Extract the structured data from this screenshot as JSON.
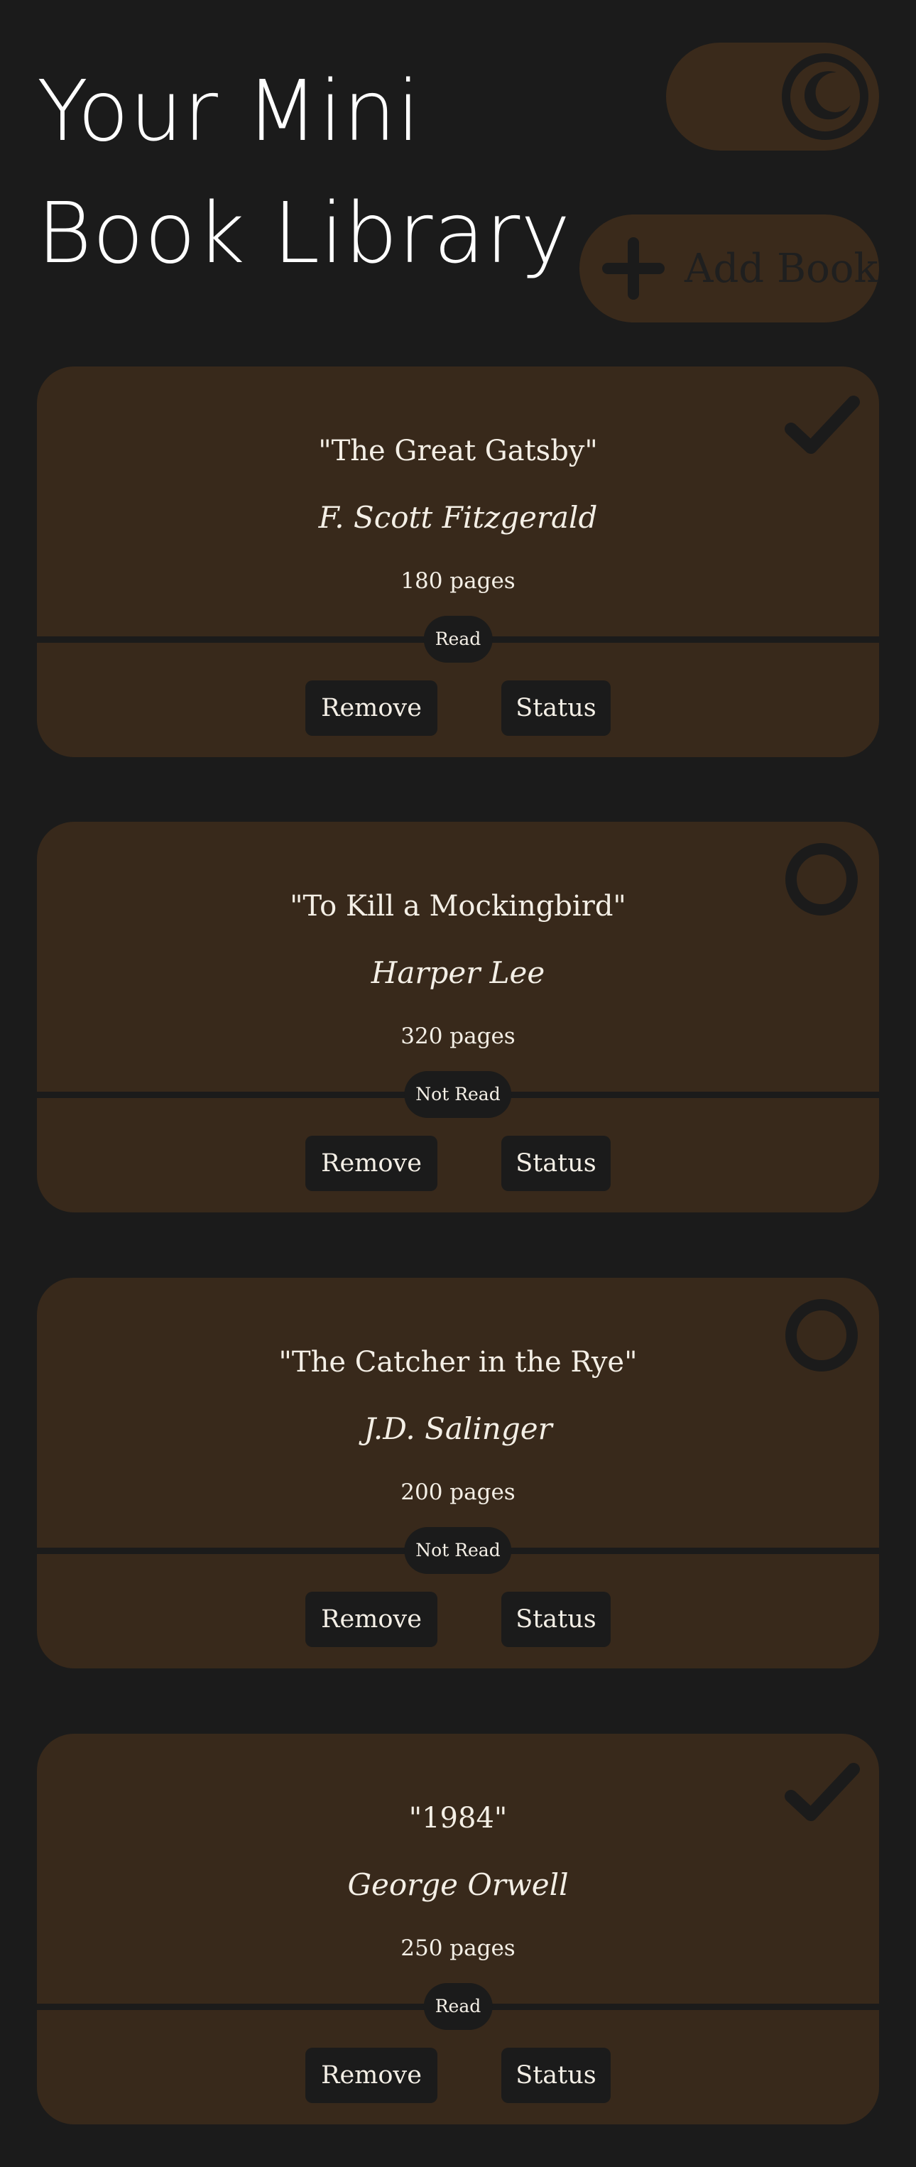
{
  "header": {
    "title_line1": "Your Mini",
    "title_line2": "Book Library",
    "add_book_label": "Add Book",
    "toggle_icon": "moon-icon",
    "add_icon": "plus-icon"
  },
  "colors": {
    "background": "#1b1b1b",
    "card": "#38291b",
    "text": "#f4efe6",
    "button": "#1b1b1b"
  },
  "books": [
    {
      "title": "\"The Great Gatsby\"",
      "author": "F. Scott Fitzgerald",
      "pages": "180 pages",
      "read_status": "Read",
      "status_icon": "checkmark-icon",
      "remove_label": "Remove",
      "status_label": "Status"
    },
    {
      "title": "\"To Kill a Mockingbird\"",
      "author": "Harper Lee",
      "pages": "320 pages",
      "read_status": "Not Read",
      "status_icon": "circle-icon",
      "remove_label": "Remove",
      "status_label": "Status"
    },
    {
      "title": "\"The Catcher in the Rye\"",
      "author": "J.D. Salinger",
      "pages": "200 pages",
      "read_status": "Not Read",
      "status_icon": "circle-icon",
      "remove_label": "Remove",
      "status_label": "Status"
    },
    {
      "title": "\"1984\"",
      "author": "George Orwell",
      "pages": "250 pages",
      "read_status": "Read",
      "status_icon": "checkmark-icon",
      "remove_label": "Remove",
      "status_label": "Status"
    }
  ]
}
